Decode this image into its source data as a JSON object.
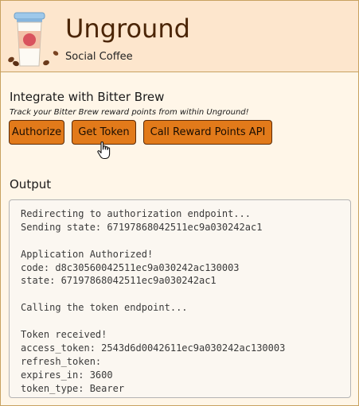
{
  "header": {
    "title": "Unground",
    "subtitle": "Social Coffee",
    "logo_icon": "coffee-cup-icon",
    "colors": {
      "header_bg": "#fde6cd",
      "title": "#4b2506",
      "page_bg": "#fff6e8",
      "button_bg": "#e27a1a"
    }
  },
  "integration": {
    "title": "Integrate with Bitter Brew",
    "description": "Track your Bitter Brew reward points from within Unground!",
    "buttons": {
      "authorize": "Authorize",
      "get_token": "Get Token",
      "call_api": "Call Reward Points API"
    }
  },
  "cursor_icon": "hand-pointer-icon",
  "output": {
    "title": "Output",
    "lines": [
      "Redirecting to authorization endpoint...",
      "Sending state: 67197868042511ec9a030242ac1",
      "",
      "Application Authorized!",
      "code: d8c30560042511ec9a030242ac130003",
      "state: 67197868042511ec9a030242ac1",
      "",
      "Calling the token endpoint...",
      "",
      "Token received!",
      "access_token: 2543d6d0042611ec9a030242ac130003",
      "refresh_token:",
      "expires_in: 3600",
      "token_type: Bearer"
    ]
  }
}
